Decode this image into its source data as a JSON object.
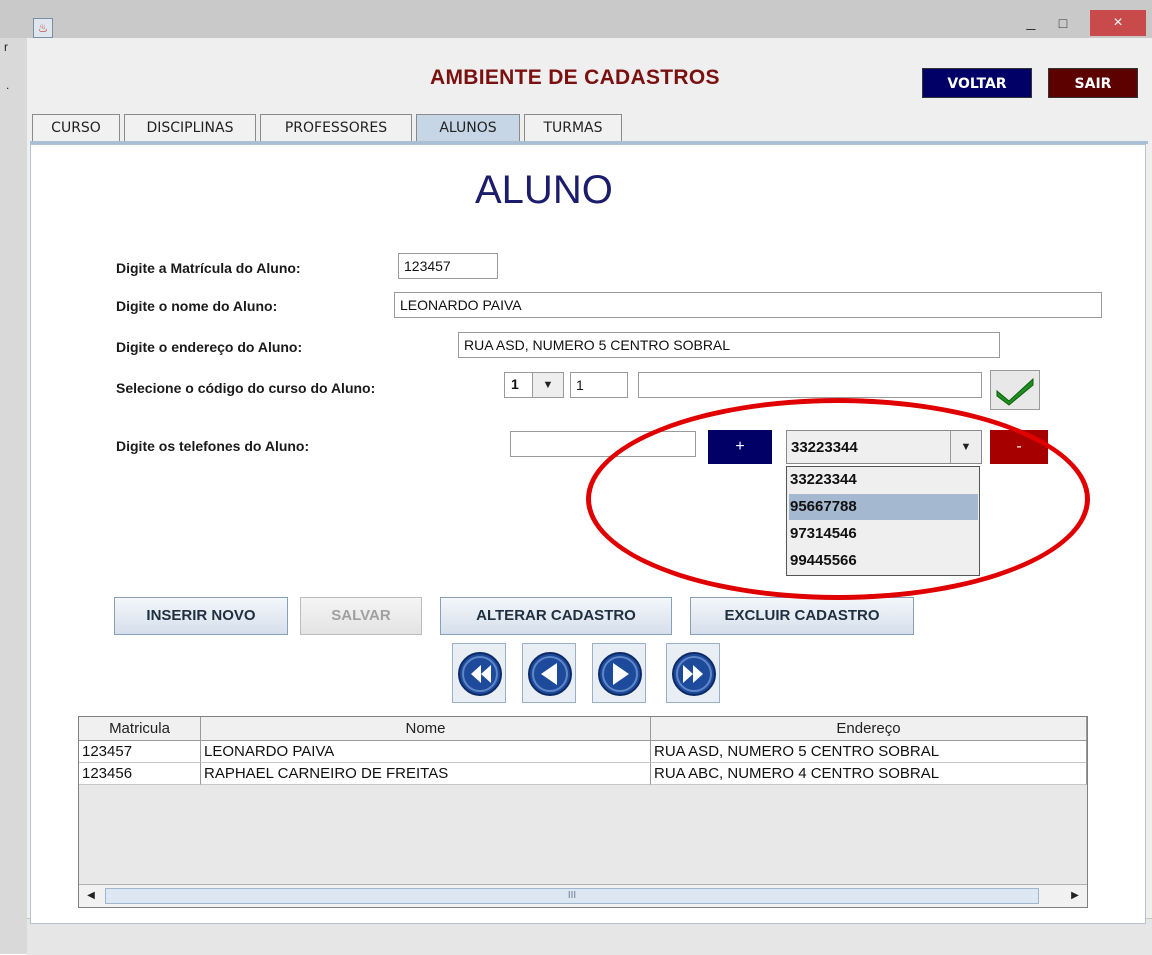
{
  "window": {
    "close_glyph": "×",
    "min_glyph": "_",
    "max_glyph": "□",
    "left_edge_text_1": "r",
    "left_edge_text_2": "."
  },
  "app": {
    "title": "AMBIENTE DE CADASTROS",
    "voltar_label": "VOLTAR",
    "sair_label": "SAIR"
  },
  "tabs": [
    {
      "label": "CURSO"
    },
    {
      "label": "DISCIPLINAS"
    },
    {
      "label": "PROFESSORES"
    },
    {
      "label": "ALUNOS",
      "active": true
    },
    {
      "label": "TURMAS"
    }
  ],
  "form": {
    "heading": "ALUNO",
    "matricula_label": "Digite a Matrícula do Aluno:",
    "matricula_value": "123457",
    "nome_label": "Digite o nome do Aluno:",
    "nome_value": "LEONARDO PAIVA",
    "endereco_label": "Digite o endereço do Aluno:",
    "endereco_value": "RUA ASD, NUMERO 5 CENTRO SOBRAL",
    "curso_label": "Selecione o código do curso do Aluno:",
    "curso_combo_value": "1",
    "curso_code_value": "1",
    "curso_name_value": "",
    "telefones_label": "Digite os telefones do Aluno:",
    "telefone_input_value": "",
    "add_phone_label": "+",
    "remove_phone_label": "-",
    "phone_combo_value": "33223344",
    "phone_options": [
      "33223344",
      "95667788",
      "97314546",
      "99445566"
    ],
    "phone_selected_index": 1
  },
  "actions": {
    "inserir_label": "INSERIR NOVO",
    "salvar_label": "SALVAR",
    "alterar_label": "ALTERAR CADASTRO",
    "excluir_label": "EXCLUIR CADASTRO"
  },
  "table": {
    "columns": [
      "Matricula",
      "Nome",
      "Endereço"
    ],
    "rows": [
      [
        "123457",
        "LEONARDO PAIVA",
        "RUA ASD, NUMERO 5 CENTRO SOBRAL"
      ],
      [
        "123456",
        "RAPHAEL CARNEIRO DE FREITAS",
        "RUA ABC, NUMERO 4 CENTRO SOBRAL"
      ]
    ],
    "scroll_thumb_glyph": "III"
  },
  "icons": {
    "check": "check-icon",
    "first": "first-record-icon",
    "prev": "previous-record-icon",
    "next": "next-record-icon",
    "last": "last-record-icon"
  },
  "colors": {
    "title": "#7a1010",
    "voltar_bg": "#000066",
    "sair_bg": "#5c0000",
    "heading": "#1c1c6c",
    "annotation": "#e00000",
    "nav_button": "#1d4a9a"
  }
}
